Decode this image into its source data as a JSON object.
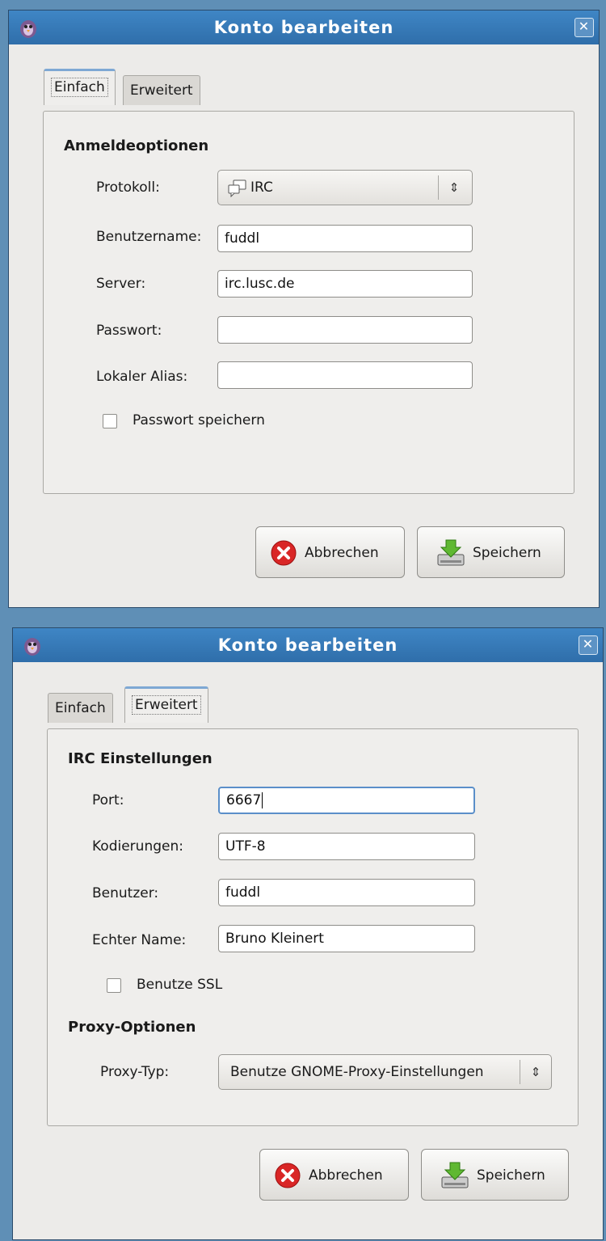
{
  "win1": {
    "title": "Konto bearbeiten",
    "tabs": {
      "einfach": "Einfach",
      "erweitert": "Erweitert"
    },
    "section_title": "Anmeldeoptionen",
    "protocol": {
      "label": "Protokoll:",
      "value": "IRC"
    },
    "username": {
      "label": "Benutzername:",
      "value": "fuddl"
    },
    "server": {
      "label": "Server:",
      "value": "irc.lusc.de"
    },
    "password": {
      "label": "Passwort:",
      "value": ""
    },
    "alias": {
      "label": "Lokaler Alias:",
      "value": ""
    },
    "remember_password": {
      "label": "Passwort speichern",
      "checked": false
    },
    "cancel_label": "Abbrechen",
    "save_label": "Speichern"
  },
  "win2": {
    "title": "Konto bearbeiten",
    "tabs": {
      "einfach": "Einfach",
      "erweitert": "Erweitert"
    },
    "section_irc": "IRC Einstellungen",
    "port": {
      "label": "Port:",
      "value": "6667"
    },
    "encodings": {
      "label": "Kodierungen:",
      "value": "UTF-8"
    },
    "user": {
      "label": "Benutzer:",
      "value": "fuddl"
    },
    "realname": {
      "label": "Echter Name:",
      "value": "Bruno Kleinert"
    },
    "use_ssl": {
      "label": "Benutze SSL",
      "checked": false
    },
    "section_proxy": "Proxy-Optionen",
    "proxy_type": {
      "label": "Proxy-Typ:",
      "value": "Benutze GNOME-Proxy-Einstellungen"
    },
    "cancel_label": "Abbrechen",
    "save_label": "Speichern"
  },
  "icons": {
    "app": "pidgin-icon",
    "close": "close-icon",
    "protocol": "chat-bubbles-icon",
    "combo": "updown-arrows-icon",
    "cancel": "red-x-icon",
    "save": "save-drive-icon"
  },
  "colors": {
    "titlebar": "#3a7fc0",
    "window_bg": "#ecebe9",
    "focus_border": "#5b8fc9",
    "cancel_red": "#d92626",
    "save_green": "#5fb832"
  }
}
